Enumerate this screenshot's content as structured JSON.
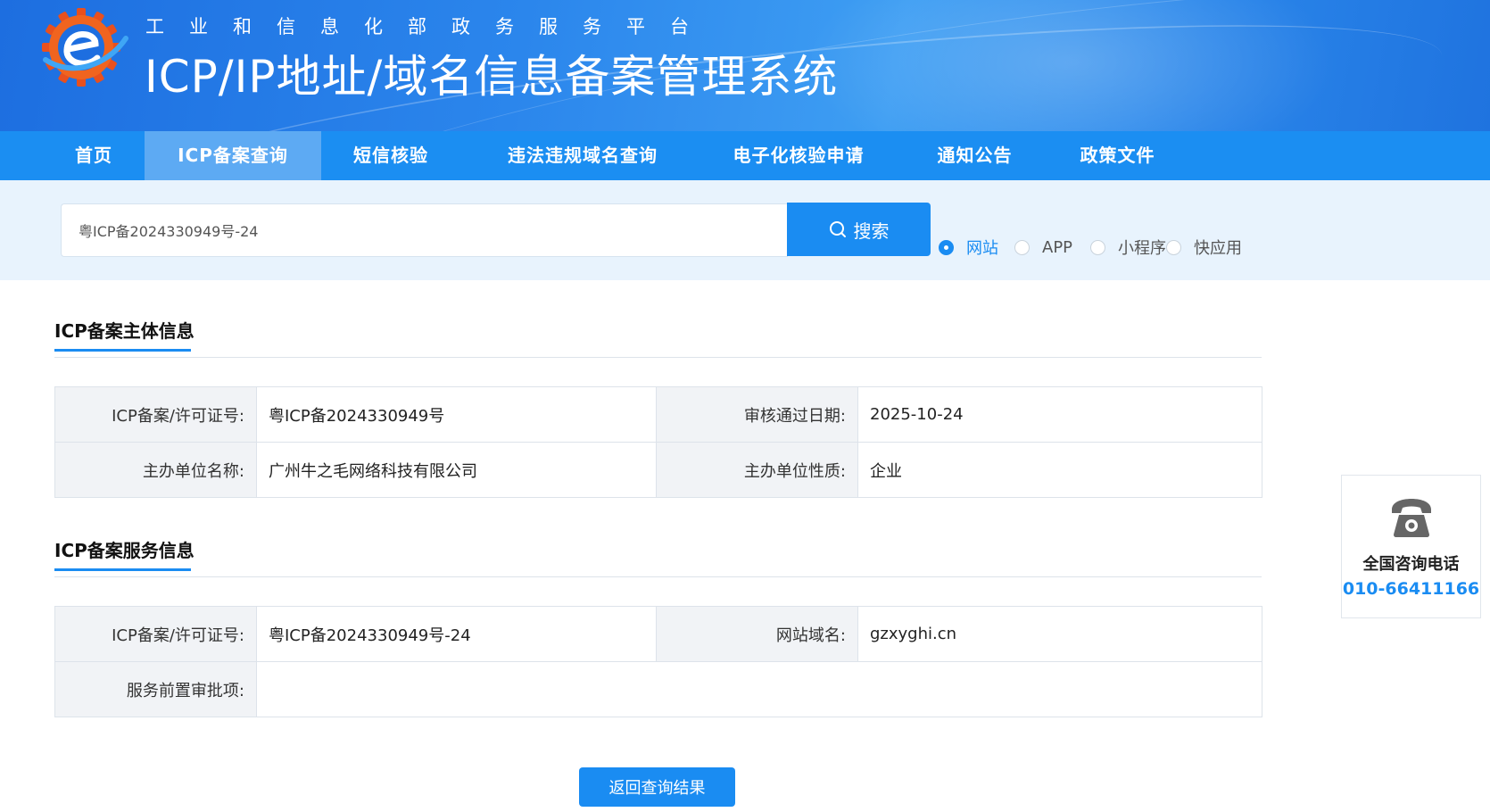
{
  "header": {
    "subtitle": "工业和信息化部政务服务平台",
    "title": "ICP/IP地址/域名信息备案管理系统",
    "logo_icon": "gear-e-logo-icon"
  },
  "nav": {
    "items": [
      {
        "label": "首页"
      },
      {
        "label": "ICP备案查询",
        "active": true
      },
      {
        "label": "短信核验"
      },
      {
        "label": "违法违规域名查询"
      },
      {
        "label": "电子化核验申请"
      },
      {
        "label": "通知公告"
      },
      {
        "label": "政策文件"
      }
    ]
  },
  "search": {
    "value": "粤ICP备2024330949号-24",
    "button_label": "搜索",
    "options": [
      {
        "label": "网站",
        "checked": true
      },
      {
        "label": "APP"
      },
      {
        "label": "小程序"
      },
      {
        "label": "快应用"
      }
    ]
  },
  "subject_info": {
    "title": "ICP备案主体信息",
    "rows": [
      {
        "label1": "ICP备案/许可证号:",
        "value1": "粤ICP备2024330949号",
        "label2": "审核通过日期:",
        "value2": "2025-10-24"
      },
      {
        "label1": "主办单位名称:",
        "value1": "广州牛之毛网络科技有限公司",
        "label2": "主办单位性质:",
        "value2": "企业"
      }
    ]
  },
  "service_info": {
    "title": "ICP备案服务信息",
    "rows": [
      {
        "label1": "ICP备案/许可证号:",
        "value1": "粤ICP备2024330949号-24",
        "label2": "网站域名:",
        "value2": "gzxyghi.cn"
      },
      {
        "label1": "服务前置审批项:",
        "value1": ""
      }
    ]
  },
  "back_button": "返回查询结果",
  "consult": {
    "label": "全国咨询电话",
    "phone": "010-66411166",
    "icon": "telephone-icon"
  },
  "colors": {
    "primary": "#1a8cf2",
    "nav_active": "#5daaf3",
    "search_band": "#e8f3fd"
  }
}
